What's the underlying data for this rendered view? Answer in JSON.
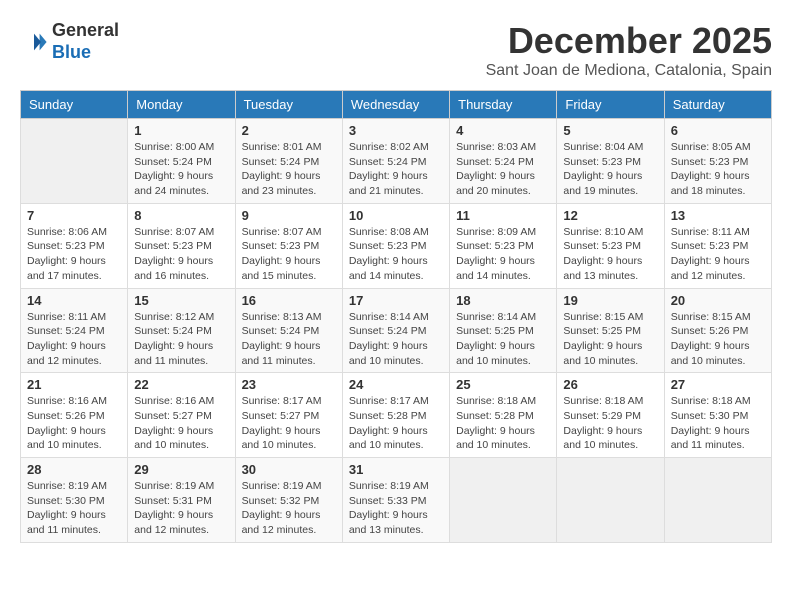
{
  "header": {
    "logo_general": "General",
    "logo_blue": "Blue",
    "month_title": "December 2025",
    "location": "Sant Joan de Mediona, Catalonia, Spain"
  },
  "days_of_week": [
    "Sunday",
    "Monday",
    "Tuesday",
    "Wednesday",
    "Thursday",
    "Friday",
    "Saturday"
  ],
  "weeks": [
    [
      {
        "day": "",
        "info": ""
      },
      {
        "day": "1",
        "info": "Sunrise: 8:00 AM\nSunset: 5:24 PM\nDaylight: 9 hours\nand 24 minutes."
      },
      {
        "day": "2",
        "info": "Sunrise: 8:01 AM\nSunset: 5:24 PM\nDaylight: 9 hours\nand 23 minutes."
      },
      {
        "day": "3",
        "info": "Sunrise: 8:02 AM\nSunset: 5:24 PM\nDaylight: 9 hours\nand 21 minutes."
      },
      {
        "day": "4",
        "info": "Sunrise: 8:03 AM\nSunset: 5:24 PM\nDaylight: 9 hours\nand 20 minutes."
      },
      {
        "day": "5",
        "info": "Sunrise: 8:04 AM\nSunset: 5:23 PM\nDaylight: 9 hours\nand 19 minutes."
      },
      {
        "day": "6",
        "info": "Sunrise: 8:05 AM\nSunset: 5:23 PM\nDaylight: 9 hours\nand 18 minutes."
      }
    ],
    [
      {
        "day": "7",
        "info": "Sunrise: 8:06 AM\nSunset: 5:23 PM\nDaylight: 9 hours\nand 17 minutes."
      },
      {
        "day": "8",
        "info": "Sunrise: 8:07 AM\nSunset: 5:23 PM\nDaylight: 9 hours\nand 16 minutes."
      },
      {
        "day": "9",
        "info": "Sunrise: 8:07 AM\nSunset: 5:23 PM\nDaylight: 9 hours\nand 15 minutes."
      },
      {
        "day": "10",
        "info": "Sunrise: 8:08 AM\nSunset: 5:23 PM\nDaylight: 9 hours\nand 14 minutes."
      },
      {
        "day": "11",
        "info": "Sunrise: 8:09 AM\nSunset: 5:23 PM\nDaylight: 9 hours\nand 14 minutes."
      },
      {
        "day": "12",
        "info": "Sunrise: 8:10 AM\nSunset: 5:23 PM\nDaylight: 9 hours\nand 13 minutes."
      },
      {
        "day": "13",
        "info": "Sunrise: 8:11 AM\nSunset: 5:23 PM\nDaylight: 9 hours\nand 12 minutes."
      }
    ],
    [
      {
        "day": "14",
        "info": "Sunrise: 8:11 AM\nSunset: 5:24 PM\nDaylight: 9 hours\nand 12 minutes."
      },
      {
        "day": "15",
        "info": "Sunrise: 8:12 AM\nSunset: 5:24 PM\nDaylight: 9 hours\nand 11 minutes."
      },
      {
        "day": "16",
        "info": "Sunrise: 8:13 AM\nSunset: 5:24 PM\nDaylight: 9 hours\nand 11 minutes."
      },
      {
        "day": "17",
        "info": "Sunrise: 8:14 AM\nSunset: 5:24 PM\nDaylight: 9 hours\nand 10 minutes."
      },
      {
        "day": "18",
        "info": "Sunrise: 8:14 AM\nSunset: 5:25 PM\nDaylight: 9 hours\nand 10 minutes."
      },
      {
        "day": "19",
        "info": "Sunrise: 8:15 AM\nSunset: 5:25 PM\nDaylight: 9 hours\nand 10 minutes."
      },
      {
        "day": "20",
        "info": "Sunrise: 8:15 AM\nSunset: 5:26 PM\nDaylight: 9 hours\nand 10 minutes."
      }
    ],
    [
      {
        "day": "21",
        "info": "Sunrise: 8:16 AM\nSunset: 5:26 PM\nDaylight: 9 hours\nand 10 minutes."
      },
      {
        "day": "22",
        "info": "Sunrise: 8:16 AM\nSunset: 5:27 PM\nDaylight: 9 hours\nand 10 minutes."
      },
      {
        "day": "23",
        "info": "Sunrise: 8:17 AM\nSunset: 5:27 PM\nDaylight: 9 hours\nand 10 minutes."
      },
      {
        "day": "24",
        "info": "Sunrise: 8:17 AM\nSunset: 5:28 PM\nDaylight: 9 hours\nand 10 minutes."
      },
      {
        "day": "25",
        "info": "Sunrise: 8:18 AM\nSunset: 5:28 PM\nDaylight: 9 hours\nand 10 minutes."
      },
      {
        "day": "26",
        "info": "Sunrise: 8:18 AM\nSunset: 5:29 PM\nDaylight: 9 hours\nand 10 minutes."
      },
      {
        "day": "27",
        "info": "Sunrise: 8:18 AM\nSunset: 5:30 PM\nDaylight: 9 hours\nand 11 minutes."
      }
    ],
    [
      {
        "day": "28",
        "info": "Sunrise: 8:19 AM\nSunset: 5:30 PM\nDaylight: 9 hours\nand 11 minutes."
      },
      {
        "day": "29",
        "info": "Sunrise: 8:19 AM\nSunset: 5:31 PM\nDaylight: 9 hours\nand 12 minutes."
      },
      {
        "day": "30",
        "info": "Sunrise: 8:19 AM\nSunset: 5:32 PM\nDaylight: 9 hours\nand 12 minutes."
      },
      {
        "day": "31",
        "info": "Sunrise: 8:19 AM\nSunset: 5:33 PM\nDaylight: 9 hours\nand 13 minutes."
      },
      {
        "day": "",
        "info": ""
      },
      {
        "day": "",
        "info": ""
      },
      {
        "day": "",
        "info": ""
      }
    ]
  ]
}
